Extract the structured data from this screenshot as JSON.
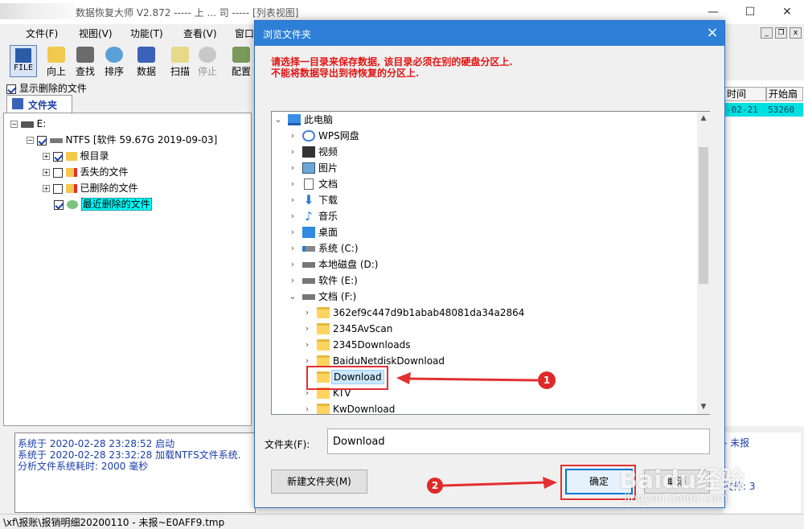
{
  "main": {
    "title": "数据恢复大师 V2.872  ----- 上 ... 司 ----- [列表视图]",
    "menu": [
      "文件(F)",
      "视图(V)",
      "功能(T)",
      "查看(V)",
      "窗口"
    ],
    "toolbar": [
      "FILE",
      "向上",
      "查找",
      "排序",
      "数据",
      "扫描",
      "停止",
      "配置"
    ],
    "show_deleted": "显示删除的文件",
    "folder_tab": "文件夹",
    "tree": [
      "E:",
      "NTFS [软件 59.67G 2019-09-03]",
      "根目录",
      "丢失的文件",
      "已删除的文件",
      "最近删除的文件"
    ],
    "right_headers": [
      "时间",
      "开始扇"
    ],
    "right_cells": [
      "-02-21",
      "53260"
    ],
    "log": [
      "系统于 2020-02-28 23:28:52 启动",
      "系统于 2020-02-28 23:32:28 加载NTFS文件系统.",
      "分析文件系统耗时: 2000 毫秒"
    ],
    "right_log": [
      "- 未报",
      "文件: 3"
    ],
    "status": "\\xf\\报账\\报销明细20200110 - 未报~E0AFF9.tmp"
  },
  "dialog": {
    "title": "浏览文件夹",
    "close": "×",
    "instruction_line1": "请选择一目录来保存数据, 该目录必须在别的硬盘分区上.",
    "instruction_line2": "不能将数据导出到待恢复的分区上.",
    "tree": {
      "root": "此电脑",
      "items": [
        "WPS网盘",
        "视频",
        "图片",
        "文档",
        "下载",
        "音乐",
        "桌面",
        "系统 (C:)",
        "本地磁盘 (D:)",
        "软件 (E:)",
        "文档 (F:)"
      ],
      "subfolders": [
        "362ef9c447d9b1abab48081da34a2864",
        "2345AvScan",
        "2345Downloads",
        "BaiduNetdiskDownload",
        "Download",
        "KTV",
        "KwDownload"
      ]
    },
    "folder_label": "文件夹(F):",
    "folder_value": "Download",
    "new_folder_button": "新建文件夹(M)",
    "ok_button": "确定",
    "cancel_button": "取消"
  },
  "annotations": {
    "badge1": "1",
    "badge2": "2"
  },
  "watermark": {
    "brand": "Baidu经验",
    "url": "jingyan.baidu.com"
  },
  "colors": {
    "accent": "#2d7fd8",
    "highlight": "#e23030",
    "selection": "#cce8ff",
    "warning_text": "#e41414"
  }
}
